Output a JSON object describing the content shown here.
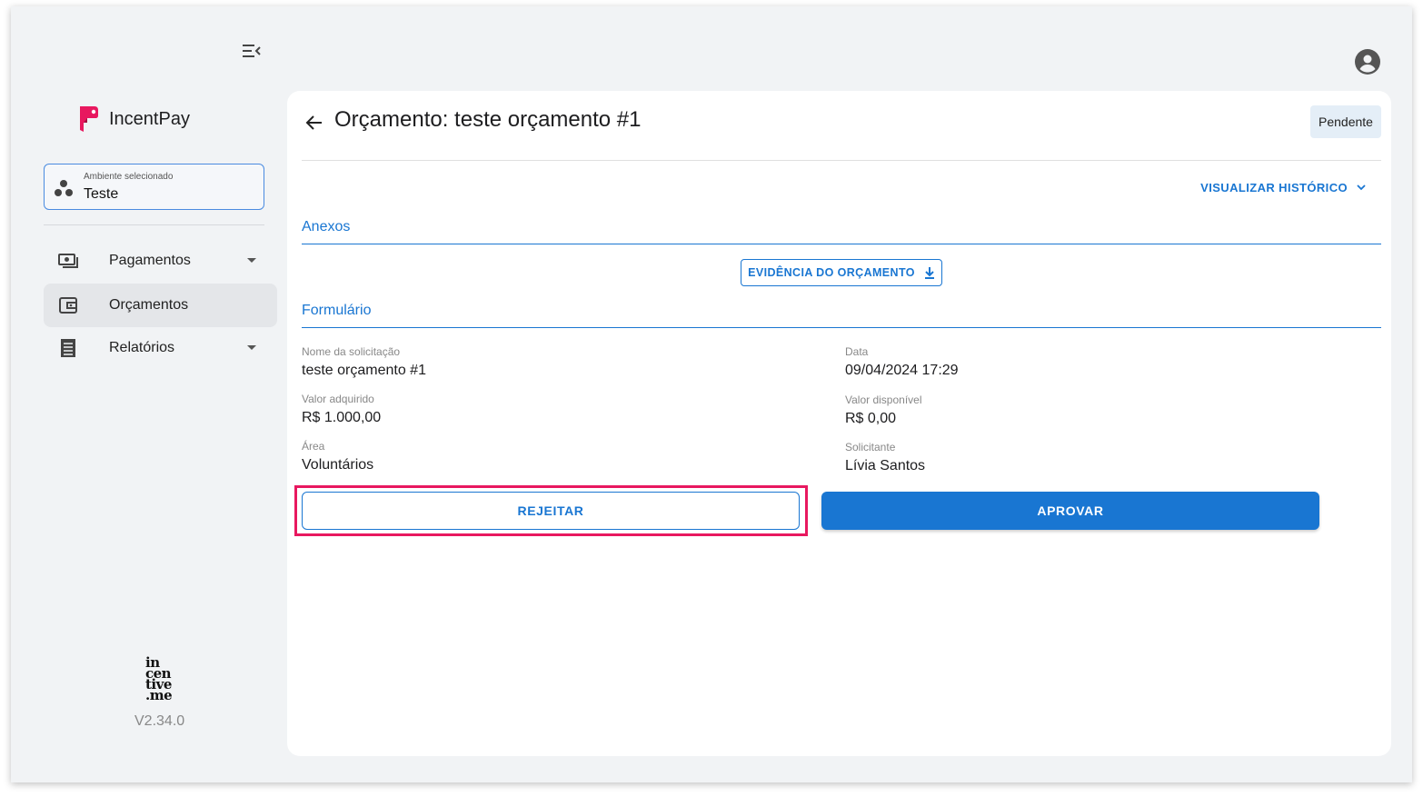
{
  "app": {
    "name": "IncentPay",
    "version": "V2.34.0",
    "footer_brand": [
      "in",
      "cen",
      "tive",
      ".me"
    ]
  },
  "environment": {
    "label": "Ambiente selecionado",
    "value": "Teste"
  },
  "sidebar": {
    "items": [
      {
        "label": "Pagamentos",
        "icon": "payments-icon",
        "expandable": true,
        "active": false
      },
      {
        "label": "Orçamentos",
        "icon": "wallet-icon",
        "expandable": false,
        "active": true
      },
      {
        "label": "Relatórios",
        "icon": "report-icon",
        "expandable": true,
        "active": false
      }
    ]
  },
  "header": {
    "title": "Orçamento: teste orçamento #1",
    "status": "Pendente",
    "history_link": "VISUALIZAR HISTÓRICO"
  },
  "attachments": {
    "section_title": "Anexos",
    "evidence_button": "EVIDÊNCIA DO ORÇAMENTO"
  },
  "form": {
    "section_title": "Formulário",
    "fields": {
      "request_name": {
        "label": "Nome da solicitação",
        "value": "teste orçamento #1"
      },
      "date": {
        "label": "Data",
        "value": "09/04/2024 17:29"
      },
      "acquired_value": {
        "label": "Valor adquirido",
        "value": "R$ 1.000,00"
      },
      "available_value": {
        "label": "Valor disponível",
        "value": "R$ 0,00"
      },
      "area": {
        "label": "Área",
        "value": "Voluntários"
      },
      "requester": {
        "label": "Solicitante",
        "value": "Lívia Santos"
      }
    }
  },
  "actions": {
    "reject": "REJEITAR",
    "approve": "APROVAR"
  },
  "colors": {
    "primary": "#1976d2",
    "highlight": "#e8185f",
    "brand": "#e8185f",
    "background": "#f1f3f5",
    "status_badge_bg": "#e4eef7"
  }
}
